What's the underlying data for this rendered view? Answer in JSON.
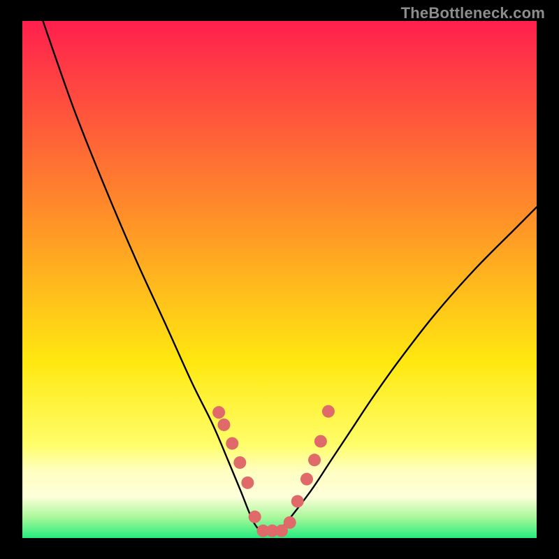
{
  "watermark": "TheBottleneck.com",
  "chart_data": {
    "type": "line",
    "title": "",
    "xlabel": "",
    "ylabel": "",
    "xlim": [
      0,
      100
    ],
    "ylim": [
      0,
      100
    ],
    "grid": false,
    "legend": false,
    "background_gradient": {
      "top_color": "#ff1f4e",
      "mid_color_1": "#ff8a2a",
      "mid_color_2": "#ffe810",
      "band_color": "#fffec0",
      "bottom_color": "#26ec7f"
    },
    "series": [
      {
        "name": "bottleneck-curve",
        "x": [
          4,
          10,
          16,
          22,
          28,
          33,
          37,
          40,
          42.5,
          45,
          47,
          49,
          50.5,
          56,
          60,
          64,
          68,
          73,
          80,
          88,
          96,
          100
        ],
        "y": [
          100,
          83,
          68,
          54,
          41,
          30,
          22,
          15,
          9,
          3,
          1,
          1,
          2,
          9,
          15,
          21,
          27,
          34,
          43,
          52,
          60,
          64
        ]
      }
    ],
    "markers": {
      "name": "highlight-points",
      "color": "#e06969",
      "radius_px": 9,
      "x": [
        38.2,
        39.2,
        40.8,
        42.3,
        43.8,
        45.2,
        46.8,
        48.6,
        50.4,
        52.0,
        53.5,
        55.3,
        56.8,
        58.0,
        59.5
      ],
      "y": [
        24.3,
        21.9,
        18.3,
        14.6,
        10.7,
        4.1,
        1.4,
        1.4,
        1.4,
        3.0,
        7.1,
        11.4,
        15.1,
        18.7,
        24.5
      ]
    }
  }
}
